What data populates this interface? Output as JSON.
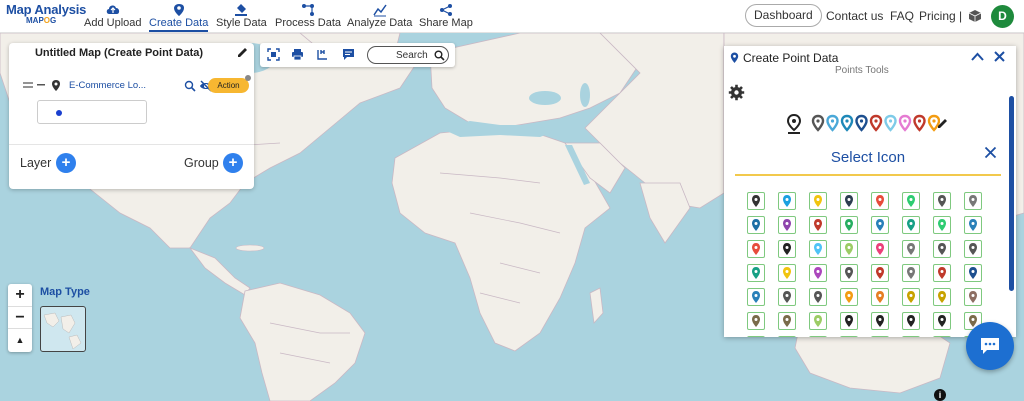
{
  "app": {
    "logo_line1": "Map Analysis",
    "logo_line2_a": "MAP",
    "logo_line2_b": "O",
    "logo_line2_c": "G"
  },
  "nav": {
    "items": [
      {
        "label": "Add Upload",
        "icon": "cloud-upload-icon"
      },
      {
        "label": "Create Data",
        "icon": "map-pin-icon",
        "active": true
      },
      {
        "label": "Style Data",
        "icon": "paint-bucket-icon"
      },
      {
        "label": "Process Data",
        "icon": "process-nodes-icon"
      },
      {
        "label": "Analyze Data",
        "icon": "analyze-chart-icon"
      },
      {
        "label": "Share Map",
        "icon": "share-icon"
      }
    ],
    "dashboard": "Dashboard",
    "contact": "Contact us",
    "faq": "FAQ",
    "pricing": "Pricing |",
    "avatar_initial": "D"
  },
  "layer_panel": {
    "map_title": "Untitled Map (Create Point Data)",
    "layer_name": "E-Commerce Lo...",
    "action_label": "Action",
    "layer_label": "Layer",
    "group_label": "Group"
  },
  "toolbar": {
    "search_label": "Search"
  },
  "point_panel": {
    "title": "Create Point Data",
    "subtitle": "Points Tools",
    "select_icon_title": "Select Icon",
    "marker_colors": [
      "#555555",
      "#4aa8d8",
      "#1e88b8",
      "#1d4f8f",
      "#c0392b",
      "#7ecbe8",
      "#e57bd2",
      "#c0392b",
      "#f39c12"
    ]
  },
  "map_controls": {
    "zoom_in": "+",
    "zoom_out": "−",
    "compass": "▲",
    "map_type_label": "Map Type"
  },
  "colors": {
    "accent": "#1d4fa3",
    "action": "#f7b731",
    "plus_button": "#2f80ed",
    "avatar": "#1e8a3c",
    "chat": "#1d6fd1"
  }
}
